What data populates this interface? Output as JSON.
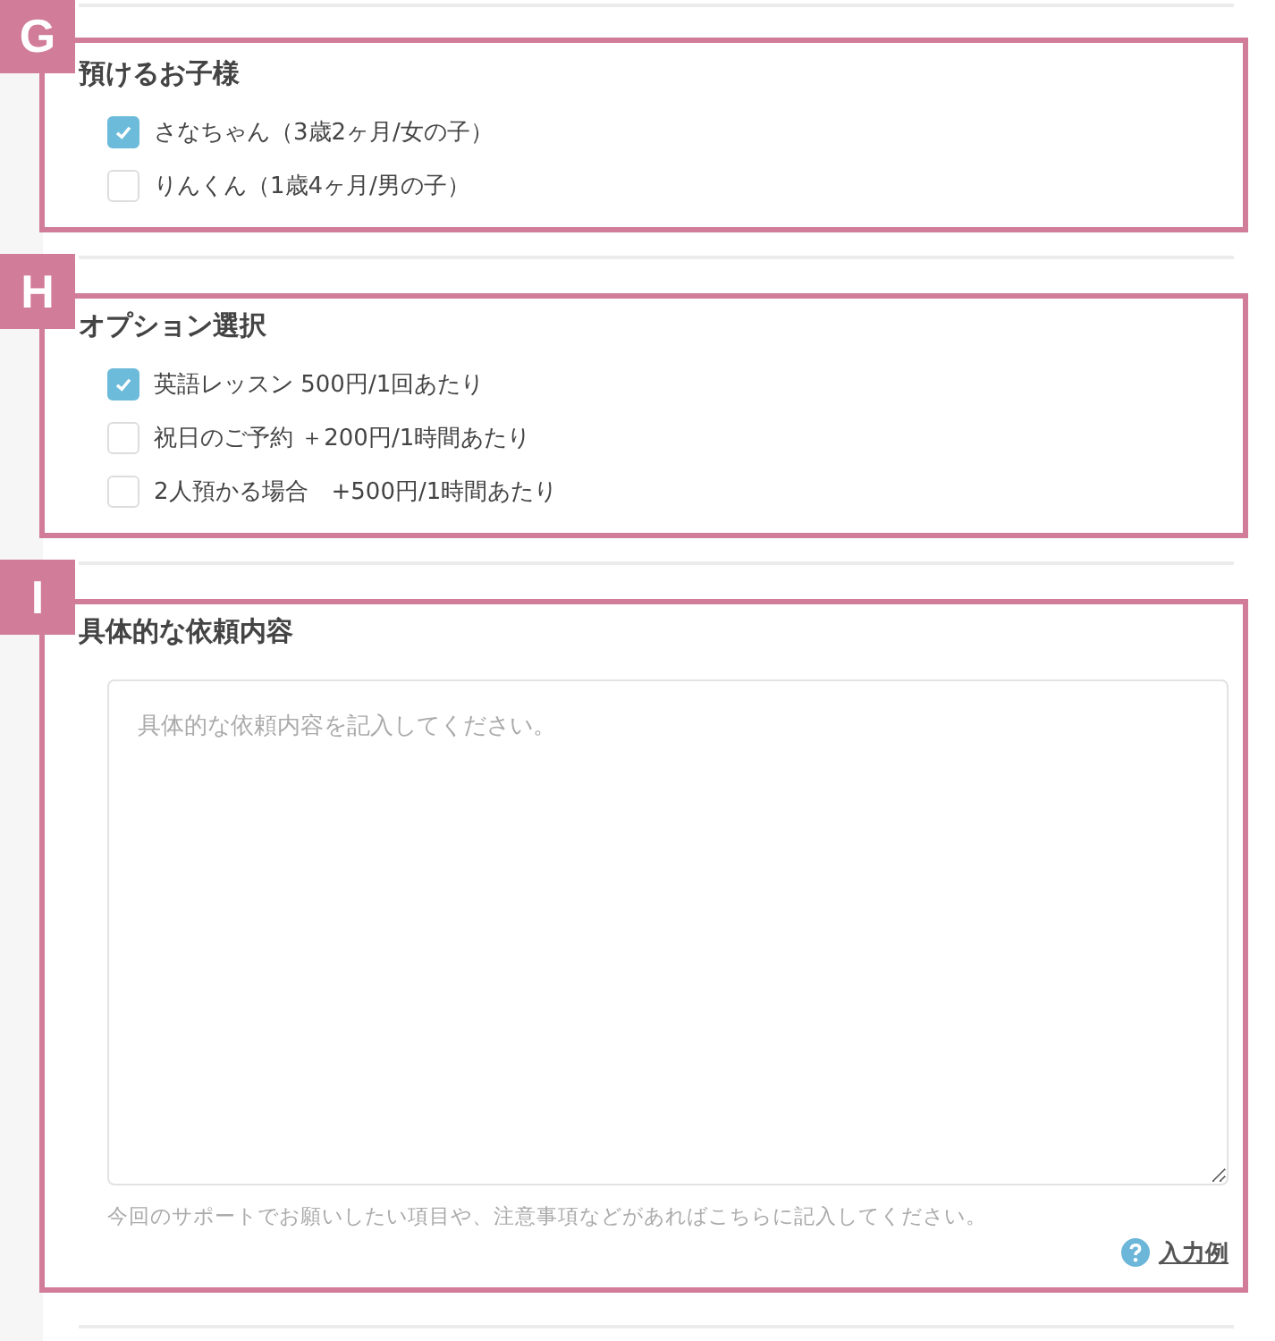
{
  "sections": [
    {
      "marker": "G",
      "title": "預けるお子様",
      "options": [
        {
          "label": "さなちゃん（3歳2ヶ月/女の子）",
          "checked": true
        },
        {
          "label": "りんくん（1歳4ヶ月/男の子）",
          "checked": false
        }
      ]
    },
    {
      "marker": "H",
      "title": "オプション選択",
      "options": [
        {
          "label": "英語レッスン 500円/1回あたり",
          "checked": true
        },
        {
          "label": "祝日のご予約 ＋200円/1時間あたり",
          "checked": false
        },
        {
          "label": "2人預かる場合　+500円/1時間あたり",
          "checked": false
        }
      ]
    },
    {
      "marker": "I",
      "title": "具体的な依頼内容",
      "textarea": {
        "placeholder": "具体的な依頼内容を記入してください。"
      },
      "hint": "今回のサポートでお願いしたい項目や、注意事項などがあればこちらに記入してください。",
      "example_link": "入力例"
    }
  ]
}
